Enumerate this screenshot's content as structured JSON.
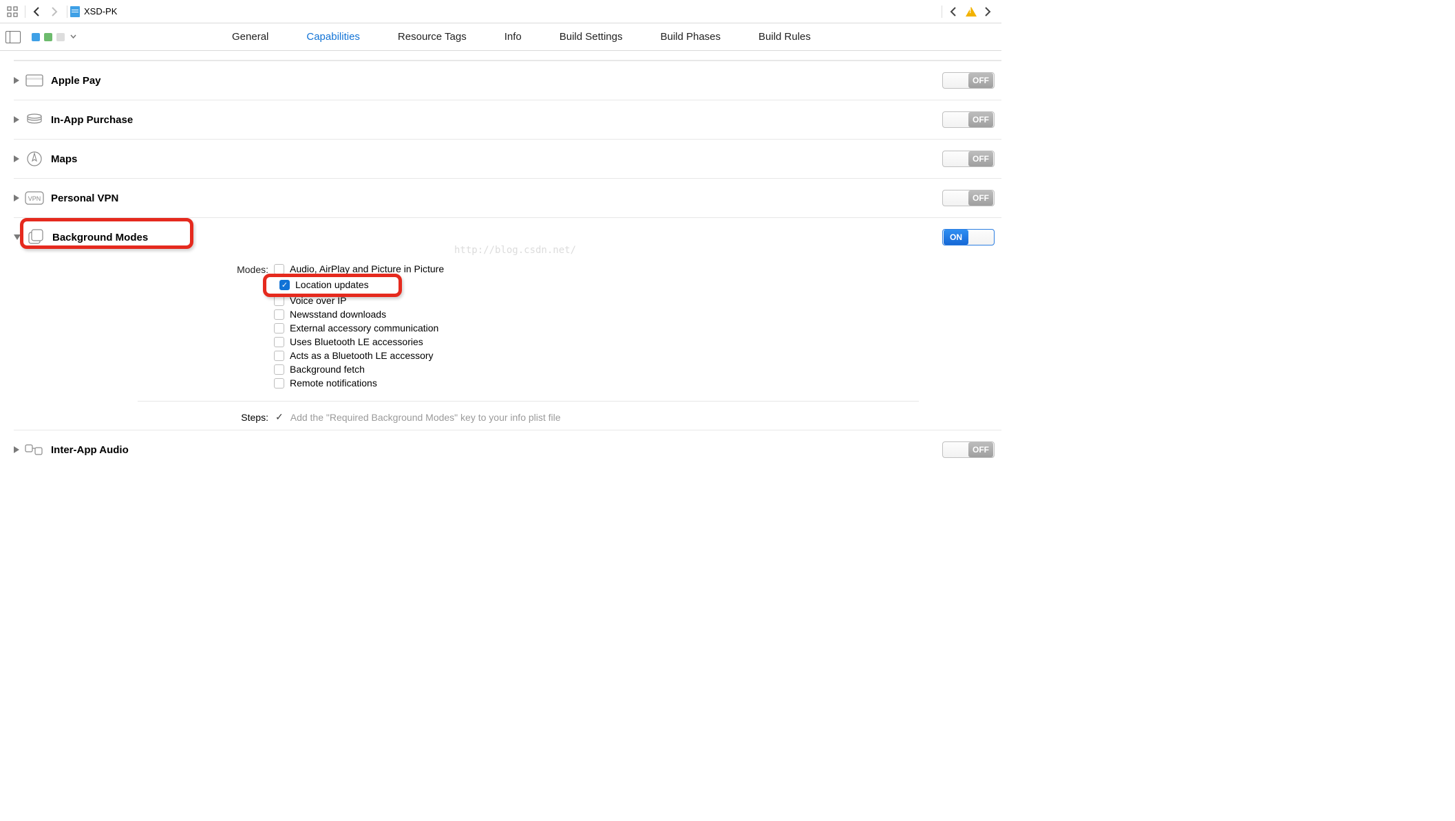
{
  "toolbar": {
    "project_name": "XSD-PK"
  },
  "tabs": {
    "general": "General",
    "capabilities": "Capabilities",
    "resource_tags": "Resource Tags",
    "info": "Info",
    "build_settings": "Build Settings",
    "build_phases": "Build Phases",
    "build_rules": "Build Rules"
  },
  "toggle": {
    "on": "ON",
    "off": "OFF"
  },
  "capabilities": [
    {
      "title": "Apple Pay",
      "on": false
    },
    {
      "title": "In-App Purchase",
      "on": false
    },
    {
      "title": "Maps",
      "on": false
    },
    {
      "title": "Personal VPN",
      "on": false
    },
    {
      "title": "Background Modes",
      "on": true
    },
    {
      "title": "Inter-App Audio",
      "on": false
    }
  ],
  "background_modes": {
    "modes_label": "Modes:",
    "options": [
      {
        "label": "Audio, AirPlay and Picture in Picture",
        "checked": false
      },
      {
        "label": "Location updates",
        "checked": true
      },
      {
        "label": "Voice over IP",
        "checked": false
      },
      {
        "label": "Newsstand downloads",
        "checked": false
      },
      {
        "label": "External accessory communication",
        "checked": false
      },
      {
        "label": "Uses Bluetooth LE accessories",
        "checked": false
      },
      {
        "label": "Acts as a Bluetooth LE accessory",
        "checked": false
      },
      {
        "label": "Background fetch",
        "checked": false
      },
      {
        "label": "Remote notifications",
        "checked": false
      }
    ],
    "steps_label": "Steps:",
    "steps_text": "Add the \"Required Background Modes\" key to your info plist file"
  },
  "watermark": "http://blog.csdn.net/"
}
